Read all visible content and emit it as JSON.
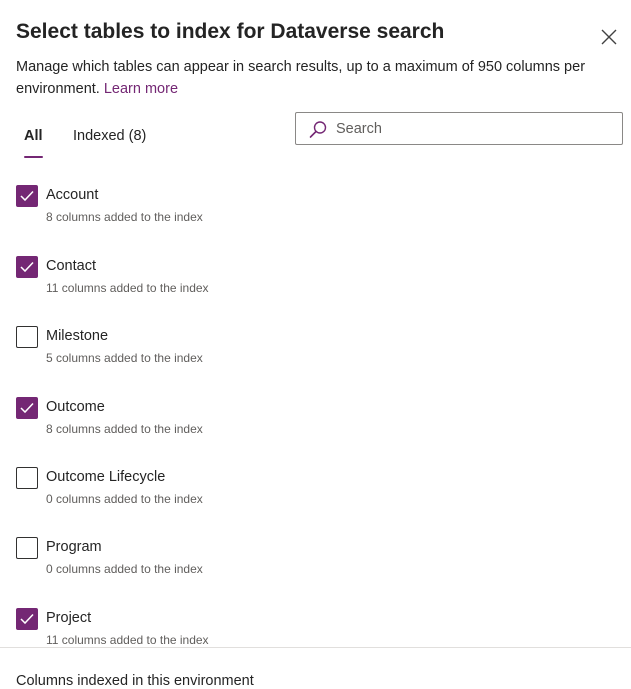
{
  "dialog": {
    "title": "Select tables to index for Dataverse search",
    "description": "Manage which tables can appear in search results, up to a maximum of 950 columns per environment.",
    "learn_more": "Learn more",
    "close_icon": "close-icon"
  },
  "tabs": [
    {
      "label": "All",
      "selected": true
    },
    {
      "label": "Indexed (8)",
      "selected": false
    }
  ],
  "search": {
    "placeholder": "Search",
    "value": "",
    "icon": "search-icon"
  },
  "tables": [
    {
      "name": "Account",
      "detail": "8 columns added to the index",
      "checked": true
    },
    {
      "name": "Contact",
      "detail": "11 columns added to the index",
      "checked": true
    },
    {
      "name": "Milestone",
      "detail": "5 columns added to the index",
      "checked": false
    },
    {
      "name": "Outcome",
      "detail": "8 columns added to the index",
      "checked": true
    },
    {
      "name": "Outcome Lifecycle",
      "detail": "0 columns added to the index",
      "checked": false
    },
    {
      "name": "Program",
      "detail": "0 columns added to the index",
      "checked": false
    },
    {
      "name": "Project",
      "detail": "11 columns added to the index",
      "checked": true
    }
  ],
  "footer": {
    "label": "Columns indexed in this environment"
  },
  "colors": {
    "accent": "#742774",
    "text": "#242424",
    "secondary_text": "#605e5c",
    "border": "#8a8886"
  }
}
